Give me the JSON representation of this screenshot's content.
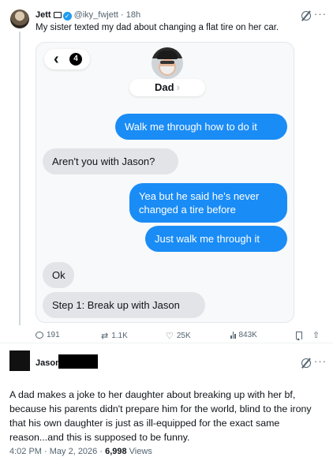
{
  "tweet": {
    "author_name": "Jett",
    "handle": "@iky_fwjett",
    "time": "18h",
    "text": "My sister texted my dad about changing a flat tire on her car.",
    "actions": {
      "replies": "191",
      "retweets": "1.1K",
      "likes": "25K",
      "views": "843K"
    }
  },
  "screenshot": {
    "back_count": "4",
    "contact_name": "Dad",
    "messages": [
      {
        "from": "me",
        "text": "Walk me through how to do it"
      },
      {
        "from": "dad",
        "text": "Aren't you with Jason?"
      },
      {
        "from": "me",
        "text": "Yea but he said he's never changed a tire before"
      },
      {
        "from": "me",
        "text": "Just walk me through it"
      },
      {
        "from": "dad",
        "text": "Ok"
      },
      {
        "from": "dad",
        "text": "Step 1: Break up with Jason"
      }
    ],
    "colors": {
      "outgoing": "#1a8cf6",
      "incoming": "#e3e4e8"
    }
  },
  "reply": {
    "author_name": "Jason",
    "text": "A dad makes a joke to her daughter about breaking up with her bf, because his parents didn't prepare him for the world, blind to the irony that his own daughter is just as ill-equipped for the exact same reason...and this is supposed to be funny.",
    "time": "4:02 PM",
    "date": "May 2, 2026",
    "views_count": "6,998",
    "views_label": "Views"
  },
  "icons": [
    "grok-icon",
    "more-icon",
    "reply-icon",
    "retweet-icon",
    "like-icon",
    "views-icon",
    "bookmark-icon",
    "share-icon",
    "back-chevron-icon",
    "verified-icon",
    "badge-icon"
  ]
}
